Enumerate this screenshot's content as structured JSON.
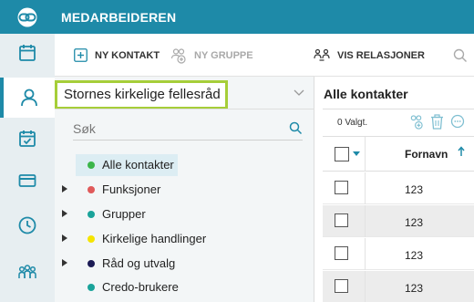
{
  "app": {
    "title": "MEDARBEIDEREN"
  },
  "rail": {
    "items": [
      {
        "name": "calendar-icon",
        "active": false
      },
      {
        "name": "person-icon",
        "active": true
      },
      {
        "name": "calendar-check-icon",
        "active": false
      },
      {
        "name": "card-icon",
        "active": false
      },
      {
        "name": "clock-icon",
        "active": false
      },
      {
        "name": "group-icon",
        "active": false
      }
    ]
  },
  "toolbar": {
    "new_contact": "NY KONTAKT",
    "new_group": "NY GRUPPE",
    "show_relations": "VIS RELASJONER"
  },
  "tree": {
    "organization": "Stornes kirkelige fellesråd",
    "search_placeholder": "Søk",
    "items": [
      {
        "label": "Alle kontakter",
        "color": "#3bb54a",
        "expandable": false,
        "selected": true
      },
      {
        "label": "Funksjoner",
        "color": "#e05a5a",
        "expandable": true,
        "selected": false
      },
      {
        "label": "Grupper",
        "color": "#1aa39a",
        "expandable": true,
        "selected": false
      },
      {
        "label": "Kirkelige handlinger",
        "color": "#f5e400",
        "expandable": true,
        "selected": false
      },
      {
        "label": "Råd og utvalg",
        "color": "#1b1b55",
        "expandable": true,
        "selected": false
      },
      {
        "label": "Credo-brukere",
        "color": "#1aa39a",
        "expandable": false,
        "selected": false
      }
    ]
  },
  "grid": {
    "title": "Alle kontakter",
    "selected_count": "0 Valgt.",
    "column": "Fornavn",
    "rows": [
      "123",
      "123",
      "123",
      "123"
    ]
  },
  "colors": {
    "brand": "#1e8aa8",
    "highlight": "#a6ce39"
  }
}
